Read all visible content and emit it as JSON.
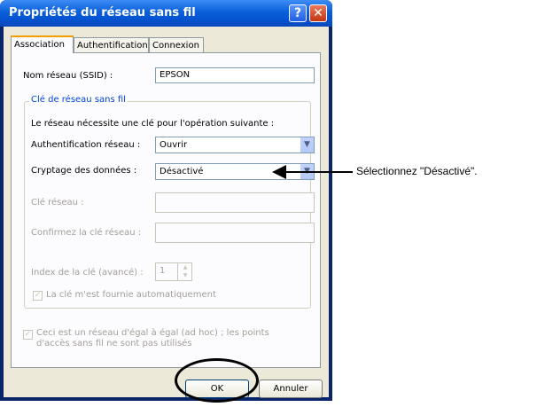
{
  "window": {
    "title": "Propriétés du réseau sans fil",
    "help_label": "?",
    "close_label": "✕"
  },
  "tabs": [
    "Association",
    "Authentification",
    "Connexion"
  ],
  "ssid": {
    "label": "Nom réseau (SSID) :",
    "value": "EPSON"
  },
  "group": {
    "legend": "Clé de réseau sans fil",
    "intro": "Le réseau nécessite une clé pour l'opération suivante :",
    "auth_label": "Authentification réseau :",
    "auth_value": "Ouvrir",
    "crypt_label": "Cryptage des données :",
    "crypt_value": "Désactivé",
    "key_label": "Clé réseau :",
    "key_value": "",
    "confirm_label": "Confirmez la clé réseau :",
    "confirm_value": "",
    "index_label": "Index de la clé (avancé) :",
    "index_value": "1",
    "auto_label": "La clé m'est fournie automatiquement"
  },
  "adhoc_label": "Ceci est un réseau d'égal à égal (ad hoc) ; les points d'accès sans fil ne sont pas utilisés",
  "buttons": {
    "ok": "OK",
    "cancel": "Annuler"
  },
  "annotation": {
    "callout": "Sélectionnez \"Désactivé\"."
  },
  "icons": {
    "dropdown": "chevron-down-icon",
    "check": "checkmark-icon",
    "spin_up": "spin-up-icon",
    "spin_down": "spin-down-icon"
  }
}
